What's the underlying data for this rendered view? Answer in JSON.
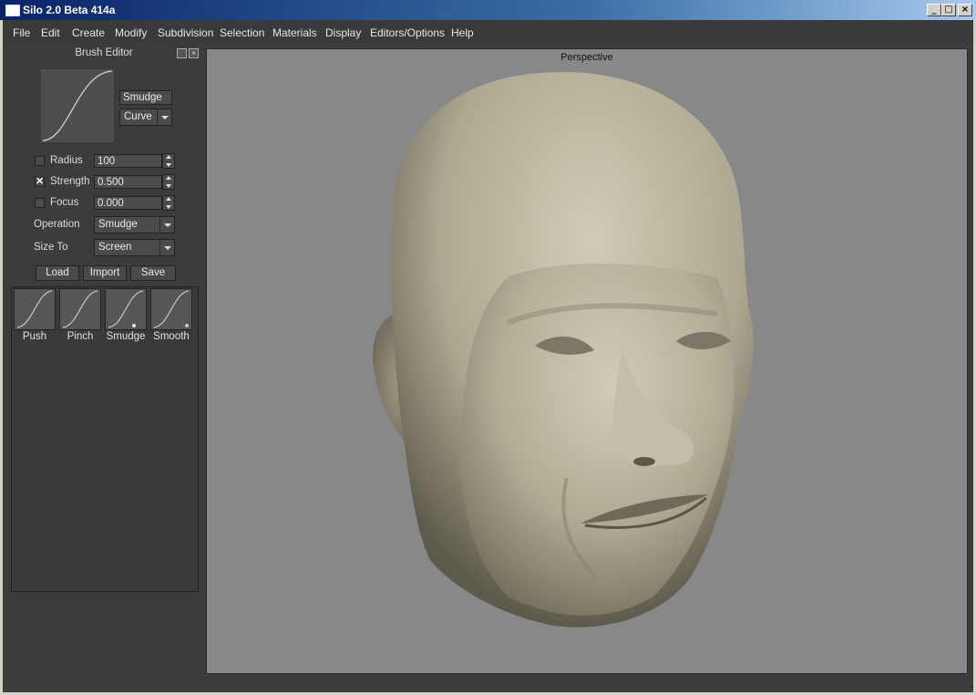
{
  "window": {
    "title": "Silo 2.0 Beta 414a"
  },
  "menu": [
    "File",
    "Edit",
    "Create",
    "Modify",
    "Subdivision",
    "Selection",
    "Materials",
    "Display",
    "Editors/Options",
    "Help"
  ],
  "brush_editor": {
    "title": "Brush Editor",
    "brush_name": "Smudge",
    "falloff_mode": "Curve",
    "radius": {
      "label": "Radius",
      "value": "100",
      "checked": false
    },
    "strength": {
      "label": "Strength",
      "value": "0.500",
      "checked": true
    },
    "focus": {
      "label": "Focus",
      "value": "0.000",
      "checked": false
    },
    "operation": {
      "label": "Operation",
      "value": "Smudge"
    },
    "size_to": {
      "label": "Size To",
      "value": "Screen"
    },
    "buttons": {
      "load": "Load",
      "import": "Import",
      "save": "Save"
    },
    "presets": [
      {
        "label": "Push"
      },
      {
        "label": "Pinch"
      },
      {
        "label": "Smudge"
      },
      {
        "label": "Smooth"
      }
    ]
  },
  "viewport": {
    "label": "Perspective"
  },
  "colors": {
    "panel": "#3c3c3c",
    "viewport_bg": "#888888",
    "model": "#b8b29c",
    "titlebar": "#0a246a"
  }
}
